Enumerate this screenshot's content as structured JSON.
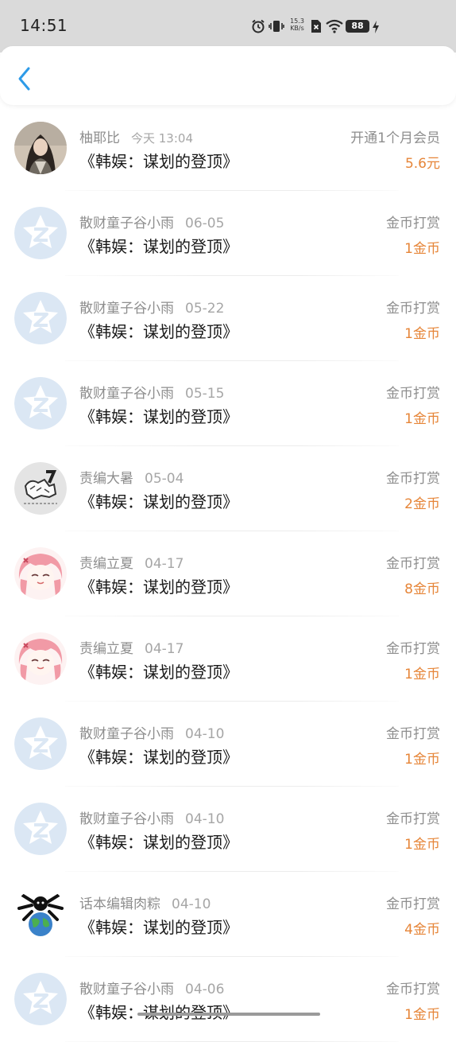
{
  "status_bar": {
    "time": "14:51",
    "speed_value": "15.3",
    "speed_unit": "KB/s",
    "battery": "88"
  },
  "nav": {
    "back_icon": "chevron-left-icon"
  },
  "colors": {
    "accent_orange": "#e68538",
    "back_blue": "#2e9be8",
    "meta_gray": "#8e8e8e"
  },
  "records": [
    {
      "name": "柚耶比",
      "date": "今天 13:04",
      "book": "《韩娱：谋划的登顶》",
      "action": "开通1个月会员",
      "amount": "5.6元",
      "avatar": "photo-avatar"
    },
    {
      "name": "散财童子谷小雨",
      "date": "06-05",
      "book": "《韩娱：谋划的登顶》",
      "action": "金币打赏",
      "amount": "1金币",
      "avatar": "default-star-avatar"
    },
    {
      "name": "散财童子谷小雨",
      "date": "05-22",
      "book": "《韩娱：谋划的登顶》",
      "action": "金币打赏",
      "amount": "1金币",
      "avatar": "default-star-avatar"
    },
    {
      "name": "散财童子谷小雨",
      "date": "05-15",
      "book": "《韩娱：谋划的登顶》",
      "action": "金币打赏",
      "amount": "1金币",
      "avatar": "default-star-avatar"
    },
    {
      "name": "责编大暑",
      "date": "05-04",
      "book": "《韩娱：谋划的登顶》",
      "action": "金币打赏",
      "amount": "2金币",
      "avatar": "sketch-avatar"
    },
    {
      "name": "责编立夏",
      "date": "04-17",
      "book": "《韩娱：谋划的登顶》",
      "action": "金币打赏",
      "amount": "8金币",
      "avatar": "anime-girl-avatar"
    },
    {
      "name": "责编立夏",
      "date": "04-17",
      "book": "《韩娱：谋划的登顶》",
      "action": "金币打赏",
      "amount": "1金币",
      "avatar": "anime-girl-avatar"
    },
    {
      "name": "散财童子谷小雨",
      "date": "04-10",
      "book": "《韩娱：谋划的登顶》",
      "action": "金币打赏",
      "amount": "1金币",
      "avatar": "default-star-avatar"
    },
    {
      "name": "散财童子谷小雨",
      "date": "04-10",
      "book": "《韩娱：谋划的登顶》",
      "action": "金币打赏",
      "amount": "1金币",
      "avatar": "default-star-avatar"
    },
    {
      "name": "话本编辑肉粽",
      "date": "04-10",
      "book": "《韩娱：谋划的登顶》",
      "action": "金币打赏",
      "amount": "4金币",
      "avatar": "globe-avatar"
    },
    {
      "name": "散财童子谷小雨",
      "date": "04-06",
      "book": "《韩娱：谋划的登顶》",
      "action": "金币打赏",
      "amount": "1金币",
      "avatar": "default-star-avatar"
    }
  ]
}
